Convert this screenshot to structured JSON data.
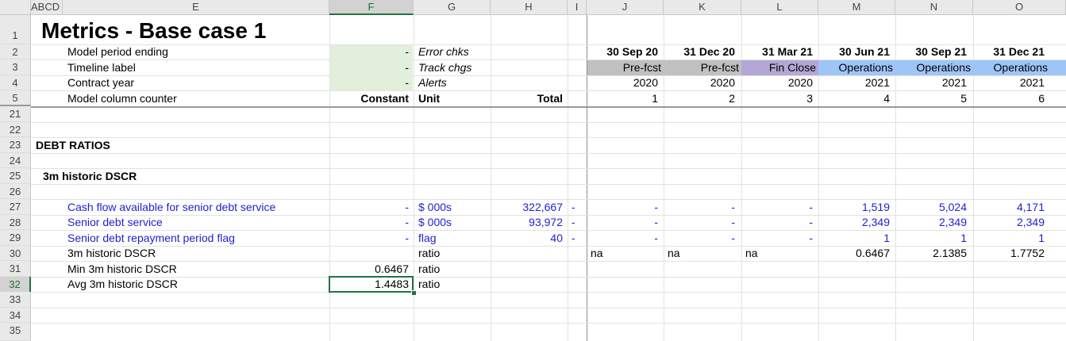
{
  "columns": [
    "ABCD",
    "E",
    "F",
    "G",
    "H",
    "I",
    "J",
    "K",
    "L",
    "M",
    "N",
    "O"
  ],
  "rows": [
    "1",
    "2",
    "3",
    "4",
    "5",
    "21",
    "22",
    "23",
    "24",
    "25",
    "26",
    "27",
    "28",
    "29",
    "30",
    "31",
    "32",
    "33",
    "34",
    "35"
  ],
  "title": "Metrics - Base case 1",
  "labels": {
    "period": "Model period ending",
    "timeline": "Timeline label",
    "contract": "Contract year",
    "counter": "Model column counter",
    "error_chks": "Error chks",
    "track_chgs": "Track chgs",
    "alerts": "Alerts",
    "constant": "Constant",
    "unit": "Unit",
    "total": "Total",
    "debt_ratios": "DEBT RATIOS",
    "dscr_section": "3m historic DSCR",
    "cfads": "Cash flow available for senior debt service",
    "sds": "Senior debt service",
    "flag": "Senior debt repayment period flag",
    "dscr": "3m historic DSCR",
    "min_dscr": "Min 3m historic DSCR",
    "avg_dscr": "Avg 3m historic DSCR"
  },
  "dash": "-",
  "f_values": {
    "min": "0.6467",
    "avg": "1.4483"
  },
  "units": {
    "k": "$ 000s",
    "flag": "flag",
    "ratio": "ratio"
  },
  "totals": {
    "cfads": "322,667",
    "sds": "93,972",
    "flag": "40"
  },
  "periods": [
    {
      "date": "30 Sep 20",
      "label": "Pre-fcst",
      "year": "2020",
      "counter": "1",
      "cfads": "-",
      "sds": "-",
      "flag": "-",
      "dscr": "na"
    },
    {
      "date": "31 Dec 20",
      "label": "Pre-fcst",
      "year": "2020",
      "counter": "2",
      "cfads": "-",
      "sds": "-",
      "flag": "-",
      "dscr": "na"
    },
    {
      "date": "31 Mar 21",
      "label": "Fin Close",
      "year": "2020",
      "counter": "3",
      "cfads": "-",
      "sds": "-",
      "flag": "-",
      "dscr": "na"
    },
    {
      "date": "30 Jun 21",
      "label": "Operations",
      "year": "2021",
      "counter": "4",
      "cfads": "1,519",
      "sds": "2,349",
      "flag": "1",
      "dscr": "0.6467"
    },
    {
      "date": "30 Sep 21",
      "label": "Operations",
      "year": "2021",
      "counter": "5",
      "cfads": "5,024",
      "sds": "2,349",
      "flag": "1",
      "dscr": "2.1385"
    },
    {
      "date": "31 Dec 21",
      "label": "Operations",
      "year": "2021",
      "counter": "6",
      "cfads": "4,171",
      "sds": "2,349",
      "flag": "1",
      "dscr": "1.7752"
    }
  ],
  "colors": {
    "pre_fcst": "#c0c0c0",
    "fin_close": "#b4a7d6",
    "operations": "#9fc5f8",
    "green_cell": "#e2efda",
    "selected_border": "#217346"
  }
}
